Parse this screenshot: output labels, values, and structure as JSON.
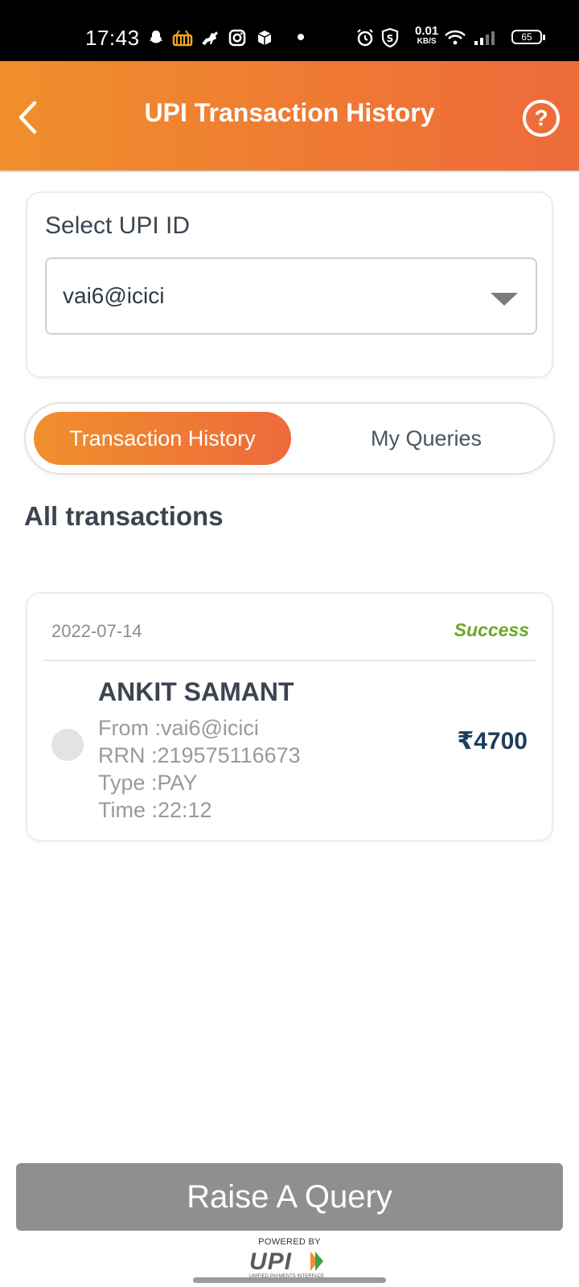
{
  "status_bar": {
    "time": "17:43",
    "net_speed": "0.01",
    "net_unit": "KB/S",
    "battery": "65",
    "icons": [
      "snapchat-icon",
      "basket-icon",
      "horse-icon",
      "instagram-icon",
      "cube-icon",
      "alarm-icon",
      "shield-s-icon",
      "wifi-icon",
      "signal-icon",
      "battery-icon"
    ]
  },
  "header": {
    "title": "UPI Transaction History"
  },
  "upi_card": {
    "label": "Select UPI ID",
    "selected_id": "vai6@icici"
  },
  "tabs": [
    {
      "label": "Transaction History",
      "active": true
    },
    {
      "label": "My Queries",
      "active": false
    }
  ],
  "section": {
    "title": "All transactions"
  },
  "transactions": [
    {
      "date": "2022-07-14",
      "status": "Success",
      "name": "ANKIT SAMANT",
      "from": "From :vai6@icici",
      "rrn": "RRN :219575116673",
      "type": "Type :PAY",
      "time": "Time :22:12",
      "amount": "₹4700"
    }
  ],
  "footer": {
    "button_label": "Raise A Query",
    "powered_by": "POWERED BY",
    "logo_text": "UPI",
    "logo_subtext": "UNIFIED PAYMENTS INTERFACE"
  },
  "colors": {
    "accent_start": "#f08f2c",
    "accent_end": "#ee6a3b",
    "success": "#6aa82a",
    "amount": "#1f3d5c",
    "button_disabled": "#8f8f8f"
  }
}
